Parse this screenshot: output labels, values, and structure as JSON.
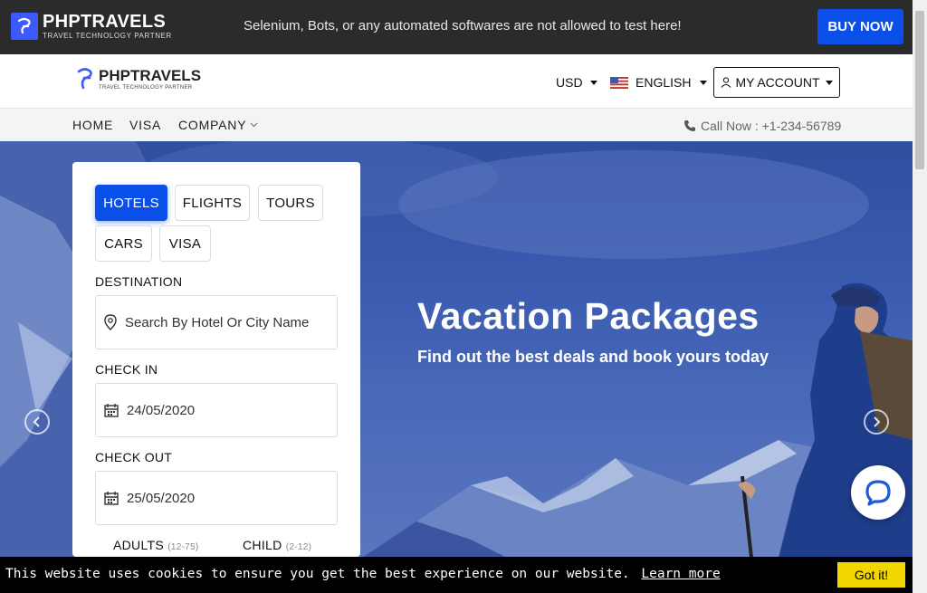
{
  "topbar": {
    "logo_name": "PHPTRAVELS",
    "logo_tagline": "TRAVEL TECHNOLOGY PARTNER",
    "notice": "Selenium, Bots, or any automated softwares are not allowed to test here!",
    "buy_label": "BUY NOW"
  },
  "header": {
    "logo_name": "PHPTRAVELS",
    "logo_tagline": "TRAVEL TECHNOLOGY PARTNER",
    "currency": "USD",
    "language": "ENGLISH",
    "account_label": "MY ACCOUNT"
  },
  "nav": {
    "items": [
      "HOME",
      "VISA",
      "COMPANY"
    ],
    "call": "Call Now : +1-234-56789"
  },
  "hero": {
    "title": "Vacation Packages",
    "subtitle": "Find out the best deals and book yours today"
  },
  "search": {
    "tabs": [
      "HOTELS",
      "FLIGHTS",
      "TOURS",
      "CARS",
      "VISA"
    ],
    "active_tab": "HOTELS",
    "destination_label": "DESTINATION",
    "destination_placeholder": "Search By Hotel Or City Name",
    "checkin_label": "CHECK IN",
    "checkin_value": "24/05/2020",
    "checkout_label": "CHECK OUT",
    "checkout_value": "25/05/2020",
    "adults_label": "ADULTS",
    "adults_range": "(12-75)",
    "child_label": "CHILD",
    "child_range": "(2-12)"
  },
  "cookie": {
    "message": "This website uses cookies to ensure you get the best experience on our website.",
    "learn_more": "Learn more",
    "got_it": "Got it!"
  },
  "colors": {
    "accent": "#0a50e8",
    "topbar": "#2b2b2b",
    "cookie_button": "#f1d600"
  }
}
